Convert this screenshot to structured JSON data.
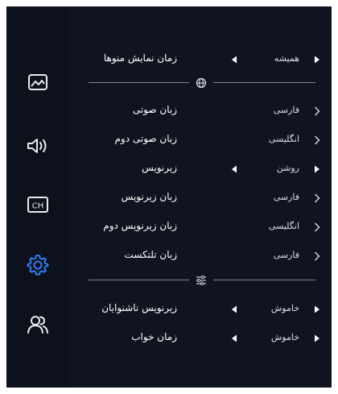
{
  "sidebar": {
    "items": [
      {
        "name": "picture",
        "icon": "image-icon"
      },
      {
        "name": "sound",
        "icon": "speaker-icon"
      },
      {
        "name": "channels",
        "icon": "ch-icon",
        "label": "CH"
      },
      {
        "name": "settings",
        "icon": "gear-icon",
        "active": true
      },
      {
        "name": "users",
        "icon": "users-icon"
      }
    ]
  },
  "menu": {
    "section1": [
      {
        "label": "زمان نمایش منوها",
        "value": "همیشه",
        "indicator": "play",
        "left_arrow": true
      }
    ],
    "section2": [
      {
        "label": "زبان صوتی",
        "value": "فارسی",
        "indicator": "chevron"
      },
      {
        "label": "زبان صوتی دوم",
        "value": "انگلیسی",
        "indicator": "chevron"
      },
      {
        "label": "زیرنویس",
        "value": "روشن",
        "indicator": "play",
        "left_arrow": true
      },
      {
        "label": "زبان زیرنویس",
        "value": "فارسی",
        "indicator": "chevron"
      },
      {
        "label": "زبان زیرنویس دوم",
        "value": "انگلیسی",
        "indicator": "chevron"
      },
      {
        "label": "زبان تلتکست",
        "value": "فارسی",
        "indicator": "chevron"
      }
    ],
    "section3": [
      {
        "label": "زیرنویس ناشنوایان",
        "value": "خاموش",
        "indicator": "play",
        "left_arrow": true
      },
      {
        "label": "زمان خواب",
        "value": "خاموش",
        "indicator": "play",
        "left_arrow": true
      }
    ]
  },
  "colors": {
    "background": "#0f1420",
    "sidebar": "#0c111b",
    "active_accent": "#2d7df6",
    "text": "#ffffff",
    "icon": "#e7ebf2"
  }
}
